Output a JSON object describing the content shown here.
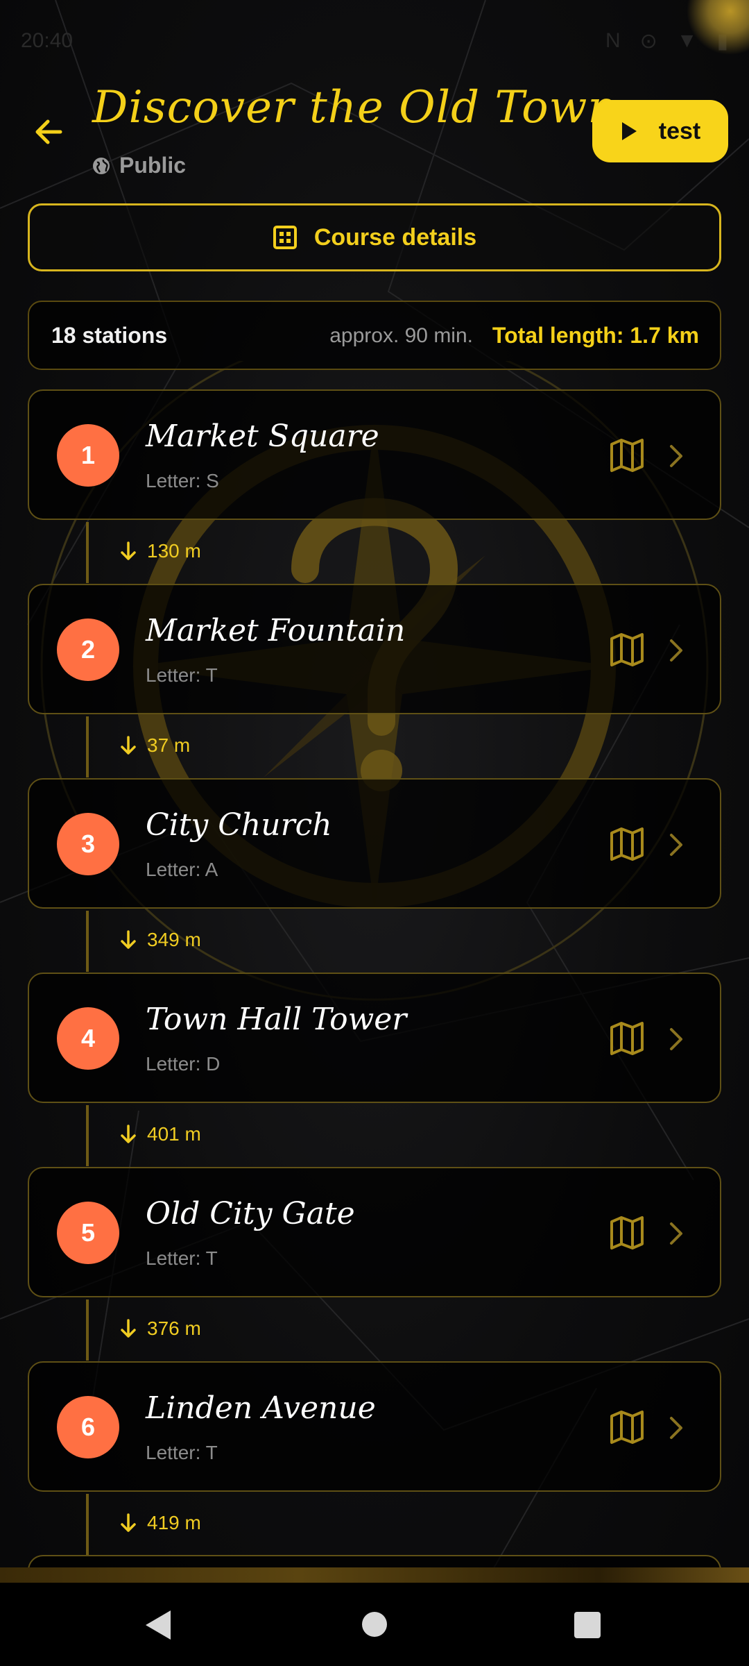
{
  "status": {
    "time": "20:40"
  },
  "header": {
    "title": "Discover the Old Town",
    "visibility": "Public",
    "test_label": "test"
  },
  "course_details_label": "Course details",
  "summary": {
    "stations": "18 stations",
    "duration": "approx. 90 min.",
    "length": "Total length: 1.7 km"
  },
  "stations": [
    {
      "number": "1",
      "name": "Market Square",
      "letter": "Letter: S",
      "distance_to_next": "130 m"
    },
    {
      "number": "2",
      "name": "Market Fountain",
      "letter": "Letter: T",
      "distance_to_next": "37 m"
    },
    {
      "number": "3",
      "name": "City Church",
      "letter": "Letter: A",
      "distance_to_next": "349 m"
    },
    {
      "number": "4",
      "name": "Town Hall Tower",
      "letter": "Letter: D",
      "distance_to_next": "401 m"
    },
    {
      "number": "5",
      "name": "Old City Gate",
      "letter": "Letter: T",
      "distance_to_next": "376 m"
    },
    {
      "number": "6",
      "name": "Linden Avenue",
      "letter": "Letter: T",
      "distance_to_next": "419 m"
    }
  ],
  "icons": {
    "back": "arrow-left-icon",
    "visibility": "globe-icon",
    "test": "play-icon",
    "course_details": "grid-icon",
    "station_map": "map-icon",
    "station_open": "chevron-right-icon",
    "distance": "arrow-down-icon"
  },
  "colors": {
    "accent": "#f4d019",
    "station_badge": "#ff7043",
    "background": "#0d0d0e"
  }
}
